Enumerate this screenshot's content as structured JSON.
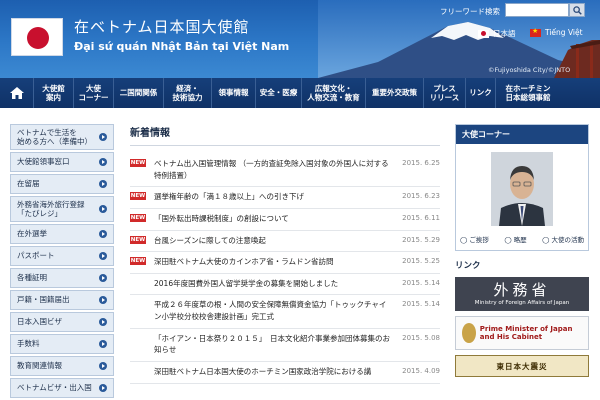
{
  "header": {
    "title_ja": "在ベトナム日本国大使館",
    "title_vi": "Đại sứ quán Nhật Bản tại Việt Nam",
    "search_label": "フリーワード検索",
    "search_value": "",
    "search_icon": "magnifier-icon",
    "languages": [
      "日本語",
      "Tiếng Việt"
    ],
    "photo_credit": "©Fujiyoshida City/©JNTO",
    "colors": {
      "header_top": "#1d5fb0",
      "flag_red": "#c8102e"
    }
  },
  "nav": {
    "home_icon": "home-icon",
    "items": [
      "大使館\n案内",
      "大使\nコーナー",
      "二国間関係",
      "経済・\n技術協力",
      "領事情報",
      "安全・医療",
      "広報文化・\n人物交流・教育",
      "重要外交政策",
      "プレス\nリリース",
      "リンク",
      "在ホーチミン\n日本総領事館"
    ]
  },
  "sidebar": {
    "items": [
      "ベトナムで生活を\n始める方へ（準備中）",
      "大使館領事窓口",
      "在留届",
      "外務省海外旅行登録\n「たびレジ」",
      "在外選挙",
      "パスポート",
      "各種証明",
      "戸籍・国籍届出",
      "日本入国ビザ",
      "手数料",
      "教育関連情報",
      "ベトナムビザ・出入国"
    ]
  },
  "main": {
    "heading": "新着情報",
    "new_badge": "NEW",
    "news": [
      {
        "title": "ベトナム出入国管理情報 （一方的査証免除入国対象の外国人に対する特例措置）",
        "date": "2015. 6.25",
        "is_new": true
      },
      {
        "title": "選挙権年齢の「満１８歳以上」への引き下げ",
        "date": "2015. 6.23",
        "is_new": true
      },
      {
        "title": "「国外転出時課税制度」の創設について",
        "date": "2015. 6.11",
        "is_new": true
      },
      {
        "title": "台風シーズンに際しての注意喚起",
        "date": "2015. 5.29",
        "is_new": true
      },
      {
        "title": "深田駐ベトナム大使のカインホア省・ラムドン省訪問",
        "date": "2015. 5.25",
        "is_new": true
      },
      {
        "title": "2016年度国費外国人留学奨学金の募集を開始しました",
        "date": "2015. 5.14",
        "is_new": false
      },
      {
        "title": "平成２６年度草の根・人間の安全保障無償資金協力「トゥックチャイン小学校分校校舎建設計画」完工式",
        "date": "2015. 5.14",
        "is_new": false
      },
      {
        "title": "「ホイアン・日本祭り２０１５」　日本文化紹介事業参加団体募集のお知らせ",
        "date": "2015. 5.08",
        "is_new": false
      },
      {
        "title": "深田駐ベトナム日本国大使のホーチミン国家政治学院における講",
        "date": "2015. 4.09",
        "is_new": false
      }
    ]
  },
  "right": {
    "ambassador_heading": "大使コーナー",
    "ambassador_links": [
      "ご挨拶",
      "略歴",
      "大使の活動"
    ],
    "links_heading": "リンク",
    "mofa_ja": "外務省",
    "mofa_en": "Ministry of Foreign Affairs of Japan",
    "pm_text": "Prime Minister of Japan and His Cabinet",
    "quake_text": "東日本大震災"
  }
}
